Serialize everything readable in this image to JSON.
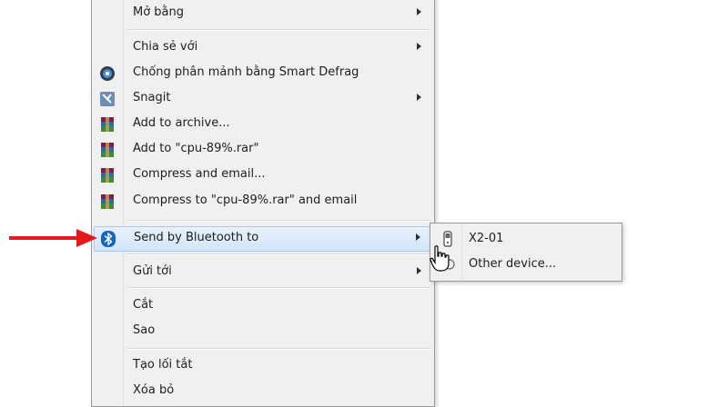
{
  "menu": {
    "items": [
      {
        "label": "Mở bằng",
        "submenu": true
      },
      {
        "label": "Chia sẻ với",
        "submenu": true
      },
      {
        "label": "Chống phân mảnh bằng Smart Defrag",
        "submenu": false,
        "icon": "smart-defrag-icon"
      },
      {
        "label": "Snagit",
        "submenu": true,
        "icon": "snagit-icon"
      },
      {
        "label": "Add to archive...",
        "submenu": false,
        "icon": "winrar-icon"
      },
      {
        "label": "Add to \"cpu-89%.rar\"",
        "submenu": false,
        "icon": "winrar-icon"
      },
      {
        "label": "Compress and email...",
        "submenu": false,
        "icon": "winrar-icon"
      },
      {
        "label": "Compress to \"cpu-89%.rar\" and email",
        "submenu": false,
        "icon": "winrar-icon"
      },
      {
        "label": "Send by Bluetooth to",
        "submenu": true,
        "icon": "bluetooth-icon",
        "highlighted": true
      },
      {
        "label": "Gửi tới",
        "submenu": true
      },
      {
        "label": "Cắt",
        "submenu": false
      },
      {
        "label": "Sao",
        "submenu": false
      },
      {
        "label": "Tạo lối tắt",
        "submenu": false
      },
      {
        "label": "Xóa bỏ",
        "submenu": false
      }
    ]
  },
  "bluetooth_submenu": {
    "items": [
      {
        "label": "X2-01",
        "icon": "phone-icon"
      },
      {
        "label": "Other device...",
        "icon": "device-icon"
      }
    ]
  },
  "colors": {
    "menu_bg": "#f0f0f0",
    "highlight_bg": "#d2e5f9",
    "highlight_border": "#a9c9ef",
    "annotation_arrow": "#e3191b",
    "bluetooth": "#1565c0"
  }
}
